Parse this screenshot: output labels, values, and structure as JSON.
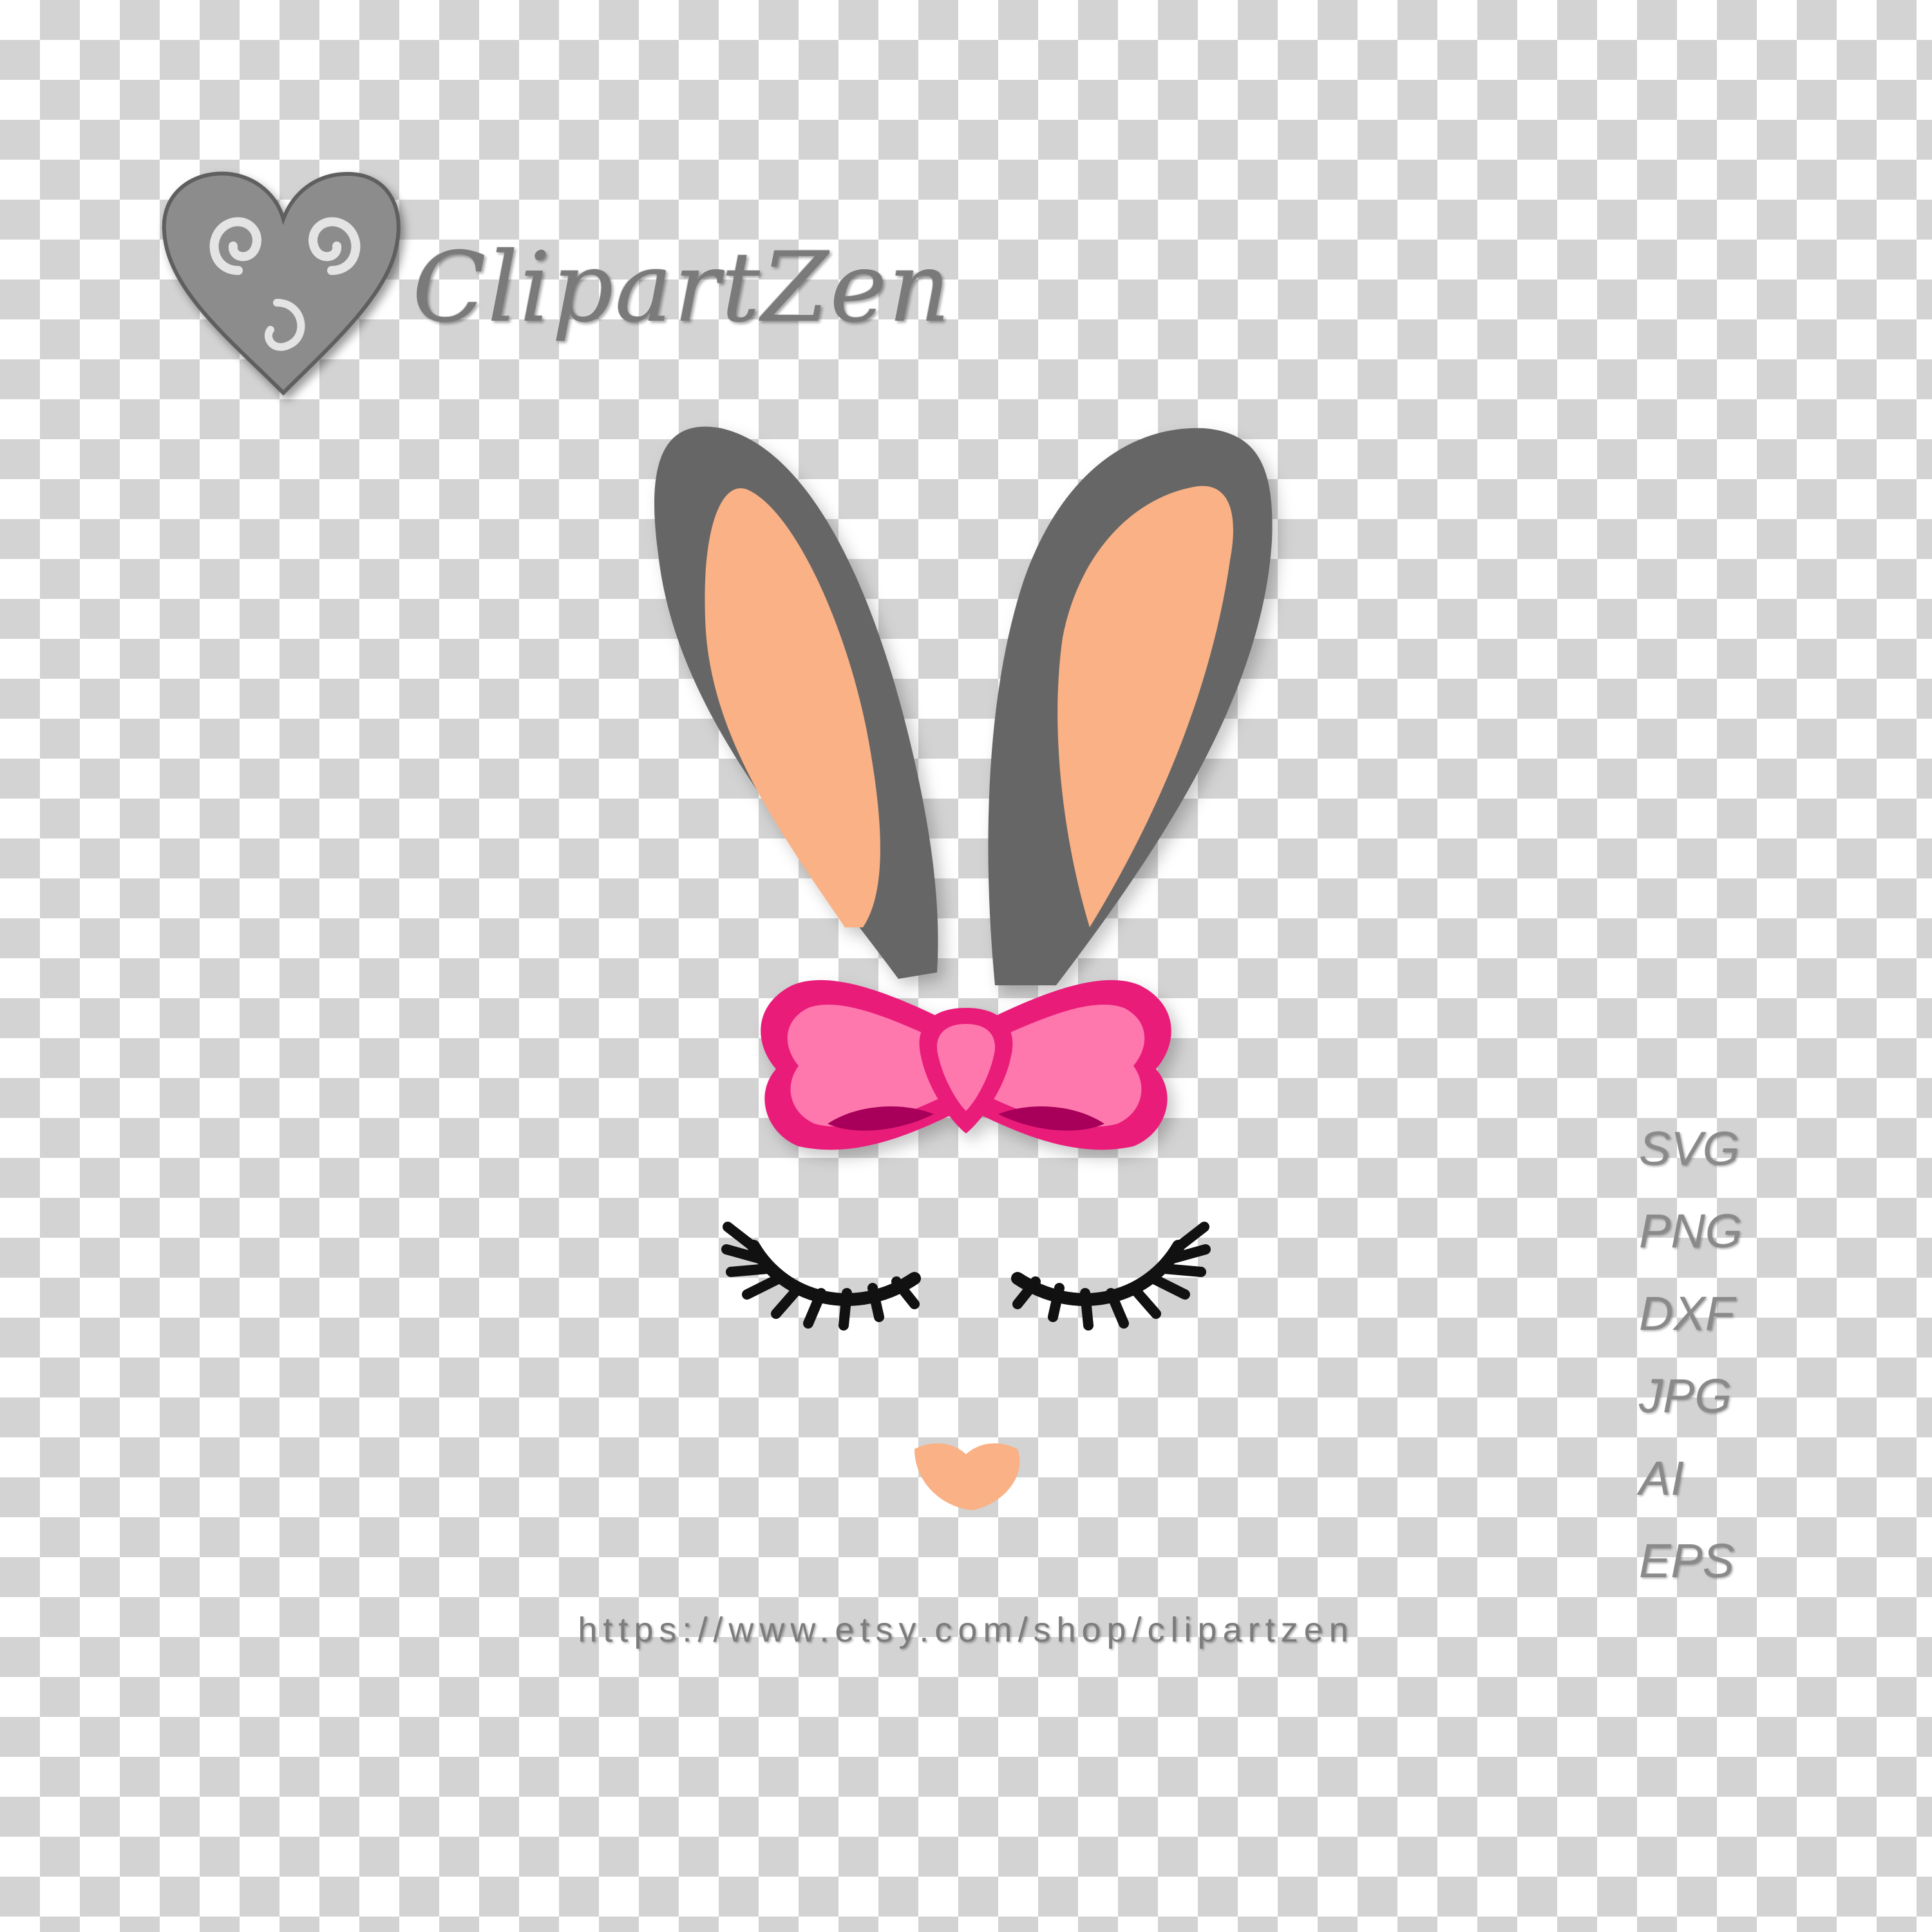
{
  "brand": {
    "name": "ClipartZen",
    "logo_icon": "heart-swirl-logo-icon",
    "color": "#7a7a7a"
  },
  "illustration": {
    "subject": "bunny-face-icon",
    "colors": {
      "ear_outer": "#666666",
      "ear_inner": "#f9b185",
      "bow_light": "#ff78ad",
      "bow_dark": "#e91e7a",
      "bow_inner": "#a8005a",
      "lashes": "#111111",
      "nose": "#f9b185"
    }
  },
  "formats": [
    "SVG",
    "PNG",
    "DXF",
    "JPG",
    "AI",
    "EPS"
  ],
  "shop_url": "https://www.etsy.com/shop/clipartzen"
}
